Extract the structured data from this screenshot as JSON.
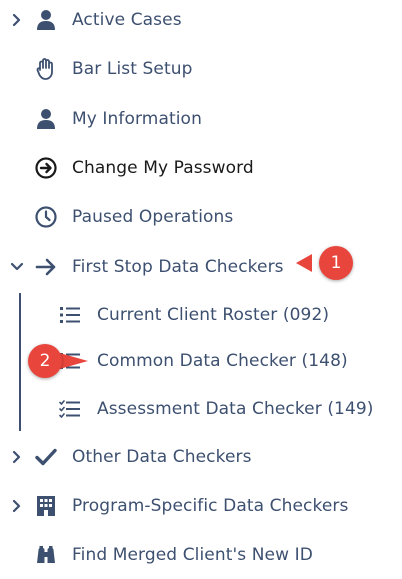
{
  "colors": {
    "text": "#3d5070",
    "active_text": "#1a1a1a",
    "badge": "#e8453c"
  },
  "menu": {
    "items": [
      {
        "label": "Active Cases",
        "icon": "user-icon",
        "expandable": true,
        "expanded": false
      },
      {
        "label": "Bar List Setup",
        "icon": "hand-icon"
      },
      {
        "label": "My Information",
        "icon": "user-icon"
      },
      {
        "label": "Change My Password",
        "icon": "circle-arrow-right-icon",
        "active": true
      },
      {
        "label": "Paused Operations",
        "icon": "clock-icon"
      },
      {
        "label": "First Stop Data Checkers",
        "icon": "arrow-right-icon",
        "expandable": true,
        "expanded": true
      },
      {
        "label": "Other Data Checkers",
        "icon": "check-icon",
        "expandable": true,
        "expanded": false
      },
      {
        "label": "Program-Specific Data Checkers",
        "icon": "building-icon",
        "expandable": true,
        "expanded": false
      },
      {
        "label": "Find Merged Client's New ID",
        "icon": "binoculars-icon"
      }
    ],
    "submenu": [
      {
        "label": "Current Client Roster (092)",
        "icon": "list-icon"
      },
      {
        "label": "Common Data Checker (148)",
        "icon": "list-icon"
      },
      {
        "label": "Assessment Data Checker (149)",
        "icon": "list-check-icon"
      }
    ]
  },
  "callouts": [
    {
      "number": "1"
    },
    {
      "number": "2"
    }
  ]
}
